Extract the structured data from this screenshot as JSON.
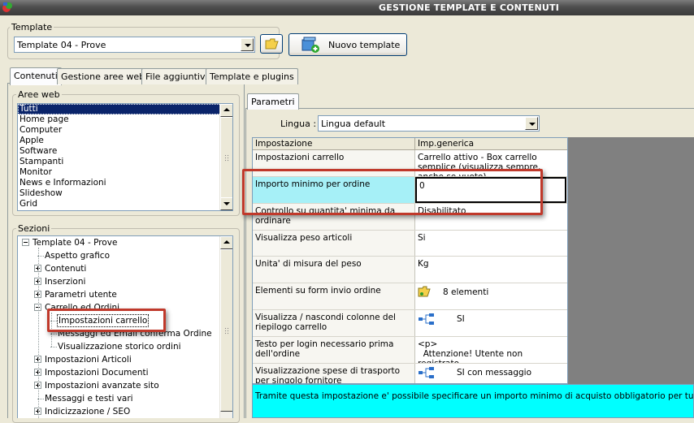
{
  "window": {
    "title": "GESTIONE TEMPLATE E CONTENUTI"
  },
  "template_group": {
    "legend": "Template",
    "selected": "Template 04 - Prove",
    "new_button": "Nuovo template"
  },
  "tabs": [
    {
      "label": "Contenuti",
      "active": true
    },
    {
      "label": "Gestione aree web"
    },
    {
      "label": "File aggiuntivi"
    },
    {
      "label": "Template e plugins"
    }
  ],
  "aree_web": {
    "legend": "Aree web",
    "items": [
      "Tutti",
      "Home page",
      "Computer",
      "Apple",
      "Software",
      "Stampanti",
      "Monitor",
      "News e Informazioni",
      "Slideshow",
      "Grid"
    ],
    "selected_index": 0
  },
  "sezioni": {
    "legend": "Sezioni",
    "items": [
      {
        "label": "Template 04 - Prove",
        "level": 0,
        "exp": "minus"
      },
      {
        "label": "Aspetto grafico",
        "level": 1,
        "exp": "none"
      },
      {
        "label": "Contenuti",
        "level": 1,
        "exp": "plus"
      },
      {
        "label": "Inserzioni",
        "level": 1,
        "exp": "plus"
      },
      {
        "label": "Parametri utente",
        "level": 1,
        "exp": "plus"
      },
      {
        "label": "Carrello ed Ordini",
        "level": 1,
        "exp": "minus"
      },
      {
        "label": "Impostazioni carrello",
        "level": 2,
        "exp": "none",
        "focused": true
      },
      {
        "label": "Messaggi ed Email conferma Ordine",
        "level": 2,
        "exp": "none"
      },
      {
        "label": "Visualizzazione storico ordini",
        "level": 2,
        "exp": "none"
      },
      {
        "label": "Impostazioni Articoli",
        "level": 1,
        "exp": "plus"
      },
      {
        "label": "Impostazioni Documenti",
        "level": 1,
        "exp": "plus"
      },
      {
        "label": "Impostazioni avanzate sito",
        "level": 1,
        "exp": "plus"
      },
      {
        "label": "Messaggi e testi vari",
        "level": 1,
        "exp": "none"
      },
      {
        "label": "Indicizzazione / SEO",
        "level": 1,
        "exp": "plus"
      }
    ]
  },
  "parametri": {
    "tab_label": "Parametri",
    "lingua_label": "Lingua :",
    "lingua_value": "Lingua default",
    "columns": [
      "Impostazione",
      "Imp.generica"
    ],
    "rows": [
      {
        "setting": "Impostazioni carrello",
        "value": "Carrello attivo - Box carrello semplice (visualizza sempre, anche se vuoto)",
        "icon": ""
      },
      {
        "setting": "Importo minimo per ordine",
        "value": "0",
        "icon": "",
        "editing": true
      },
      {
        "setting": "Controllo su quantita' minima da ordinare",
        "value": "Disabilitato",
        "icon": ""
      },
      {
        "setting": "Visualizza peso articoli",
        "value": "Si",
        "icon": ""
      },
      {
        "setting": "Unita' di misura del peso",
        "value": "Kg",
        "icon": ""
      },
      {
        "setting": "Elementi su form invio ordine",
        "value": "8 elementi",
        "icon": "folder-icon"
      },
      {
        "setting": "Visualizza / nascondi colonne del riepilogo carrello",
        "value": "SI",
        "icon": "tree-structure-icon"
      },
      {
        "setting": "Testo per login necessario prima dell'ordine",
        "value": "<p>\n  Attenzione! Utente non registrato.",
        "icon": ""
      },
      {
        "setting": "Visualizzazione spese di trasporto per singolo fornitore",
        "value": "SI con messaggio",
        "icon": "tree-structure-icon"
      }
    ],
    "description": "Tramite questa impostazione e' possibile specificare un importo minimo di acquisto obbligatorio per tutti gli ordini w"
  }
}
